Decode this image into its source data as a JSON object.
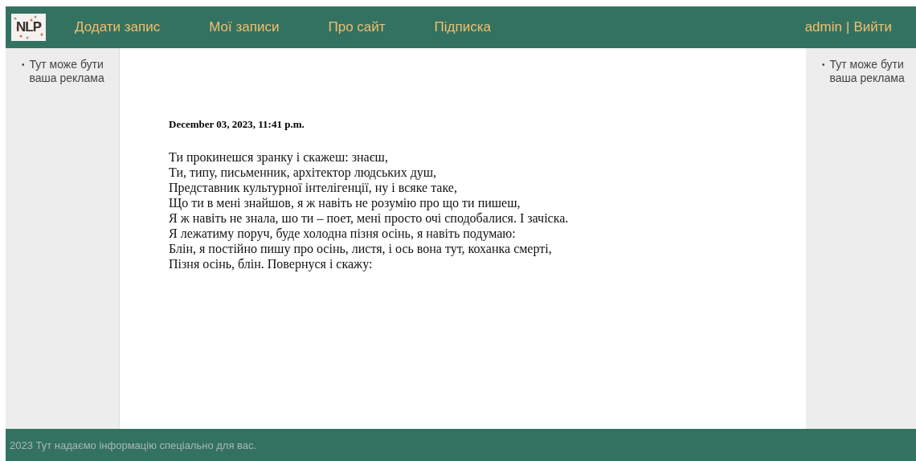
{
  "header": {
    "logo": "NLP",
    "nav": [
      "Додати запис",
      "Мої записи",
      "Про сайт",
      "Підписка"
    ],
    "user": "admin",
    "separator": "|",
    "logout": "Вийти"
  },
  "left_sidebar": {
    "items": [
      {
        "marker": "•",
        "text": "Тут може бути ваша реклама"
      }
    ]
  },
  "right_sidebar": {
    "items": [
      {
        "marker": "•",
        "text": "Тут може бути ваша реклама"
      }
    ]
  },
  "post": {
    "date": "December 03, 2023, 11:41 p.m.",
    "lines": [
      "Ти прокинешся зранку і скажеш: знаєш,",
      "Ти, типу, письменник, архітектор людських душ,",
      "Представник культурної інтелігенції, ну і всяке таке,",
      "Що ти в мені знайшов, я ж навіть не розумію про що ти пишеш,",
      "Я ж навіть не знала, шо ти – поет, мені просто очі сподобалися. І зачіска.",
      "Я лежатиму поруч, буде холодна пізня осінь, я навіть подумаю:",
      "Блін, я постійно пишу про осінь, листя, і ось вона тут, коханка смерті,",
      "Пізня осінь, блін. Повернуся і скажу:"
    ]
  },
  "footer": {
    "text": "2023 Тут надаємо інформацію спеціально для вас."
  }
}
